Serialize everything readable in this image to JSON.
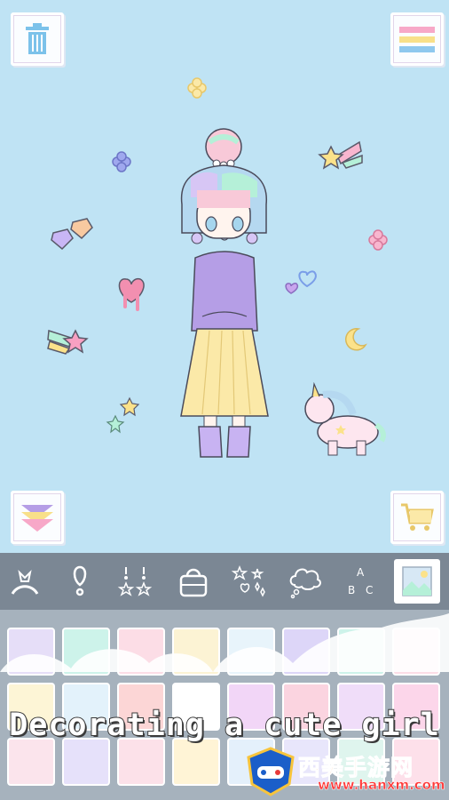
{
  "caption": "Decorating a cute girl",
  "watermark": {
    "title": "西美手游网",
    "url": "www.hanxm.com"
  },
  "icons": {
    "trash": "trash-icon",
    "menu": "menu-icon",
    "collapse": "chevron-double-down-icon",
    "shop": "shopping-cart-icon",
    "tools": [
      "headband-icon",
      "earring-icon",
      "necklace-icon",
      "bag-icon",
      "sparkles-icon",
      "speech-cloud-icon",
      "abc-text-icon",
      "background-image-icon"
    ]
  },
  "colors": {
    "background": "#bfe3f4",
    "toolbar": "#7b8794",
    "palette": "#a6b2bd",
    "sweater": "#b59ee6",
    "skirt": "#fbe9a8"
  },
  "swatches_row1": [
    "#e6def8",
    "#cdf3ea",
    "#fcdde6",
    "#fcf3d4",
    "#e8f4fb",
    "#ddd6f8",
    "#cdf3ea",
    "#fcdde6"
  ],
  "swatches_row2": [
    "#fdf5d6",
    "#e3f2fb",
    "#fcd6d6",
    "#ffffff",
    "#f2d6f7",
    "#fbd4e0",
    "#f0ddf9",
    "#fcd6ea"
  ],
  "swatches_row3": [
    "#fbe4ec",
    "#e6e1fa",
    "#fce1e9",
    "#fff4d6",
    "#e4f0fb",
    "#e8e6fb",
    "#dff5ee",
    "#fde0ea"
  ]
}
